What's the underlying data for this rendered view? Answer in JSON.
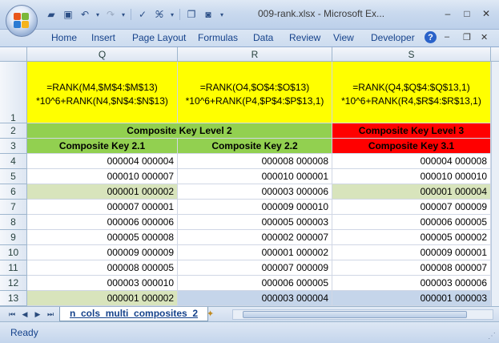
{
  "window": {
    "title": "009-rank.xlsx - Microsoft Ex...",
    "minimize": "–",
    "maximize": "□",
    "close": "✕"
  },
  "ribbon": {
    "tabs": [
      "Home",
      "Insert",
      "Page Layout",
      "Formulas",
      "Data",
      "Review",
      "View",
      "Developer"
    ],
    "help": "?"
  },
  "columns": [
    "Q",
    "R",
    "S"
  ],
  "rows": {
    "numbers": [
      "1",
      "2",
      "3",
      "4",
      "5",
      "6",
      "7",
      "8",
      "9",
      "10",
      "11",
      "12",
      "13"
    ]
  },
  "header": {
    "formulas": [
      [
        "=RANK(M4,$M$4:$M$13)",
        "*10^6+RANK(N4,$N$4:$N$13)"
      ],
      [
        "=RANK(O4,$O$4:$O$13)",
        "*10^6+RANK(P4,$P$4:$P$13,1)"
      ],
      [
        "=RANK(Q4,$Q$4:$Q$13,1)",
        "*10^6+RANK(R4,$R$4:$R$13,1)"
      ]
    ],
    "level2": "Composite Key Level 2",
    "level3": "Composite Key Level 3",
    "keys": [
      "Composite Key 2.1",
      "Composite Key 2.2",
      "Composite Key 3.1"
    ]
  },
  "data": [
    [
      "000004 000004",
      "000008 000008",
      "000004 000008"
    ],
    [
      "000010 000007",
      "000010 000001",
      "000010 000010"
    ],
    [
      "000001 000002",
      "000003 000006",
      "000001 000004"
    ],
    [
      "000007 000001",
      "000009 000010",
      "000007 000009"
    ],
    [
      "000006 000006",
      "000005 000003",
      "000006 000005"
    ],
    [
      "000005 000008",
      "000002 000007",
      "000005 000002"
    ],
    [
      "000009 000009",
      "000001 000002",
      "000009 000001"
    ],
    [
      "000008 000005",
      "000007 000009",
      "000008 000007"
    ],
    [
      "000003 000010",
      "000006 000005",
      "000003 000006"
    ],
    [
      "000001 000002",
      "000003 000004",
      "000001 000003"
    ]
  ],
  "sheet_tab": "n_cols_multi_composites_2",
  "status": "Ready"
}
